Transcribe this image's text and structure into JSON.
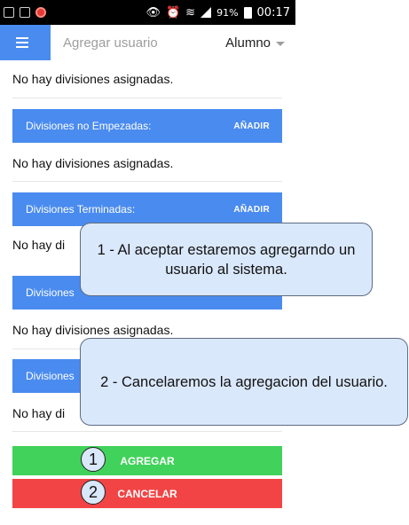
{
  "status_bar": {
    "battery": "91%",
    "time": "00:17"
  },
  "app_bar": {
    "search_placeholder": "Agregar usuario",
    "role_value": "Alumno"
  },
  "sections": [
    {
      "title": "",
      "empty_text": "No hay divisiones asignadas."
    },
    {
      "title": "Divisiones no Empezadas:",
      "add_label": "AÑADIR",
      "empty_text": "No hay divisiones asignadas."
    },
    {
      "title": "Divisiones Terminadas:",
      "add_label": "AÑADIR",
      "empty_text": "No hay di"
    },
    {
      "title": "Divisiones ",
      "empty_text": "No hay divisiones asignadas."
    },
    {
      "title": "Divisiones",
      "empty_text": "No hay di"
    }
  ],
  "buttons": {
    "agregar": "AGREGAR",
    "cancelar": "CANCELAR"
  },
  "annotations": {
    "callout_1": "1 - Al aceptar estaremos agregarndo un usuario al sistema.",
    "callout_2": "2 - Cancelaremos la agregacion del usuario.",
    "badge_1": "1",
    "badge_2": "2"
  }
}
